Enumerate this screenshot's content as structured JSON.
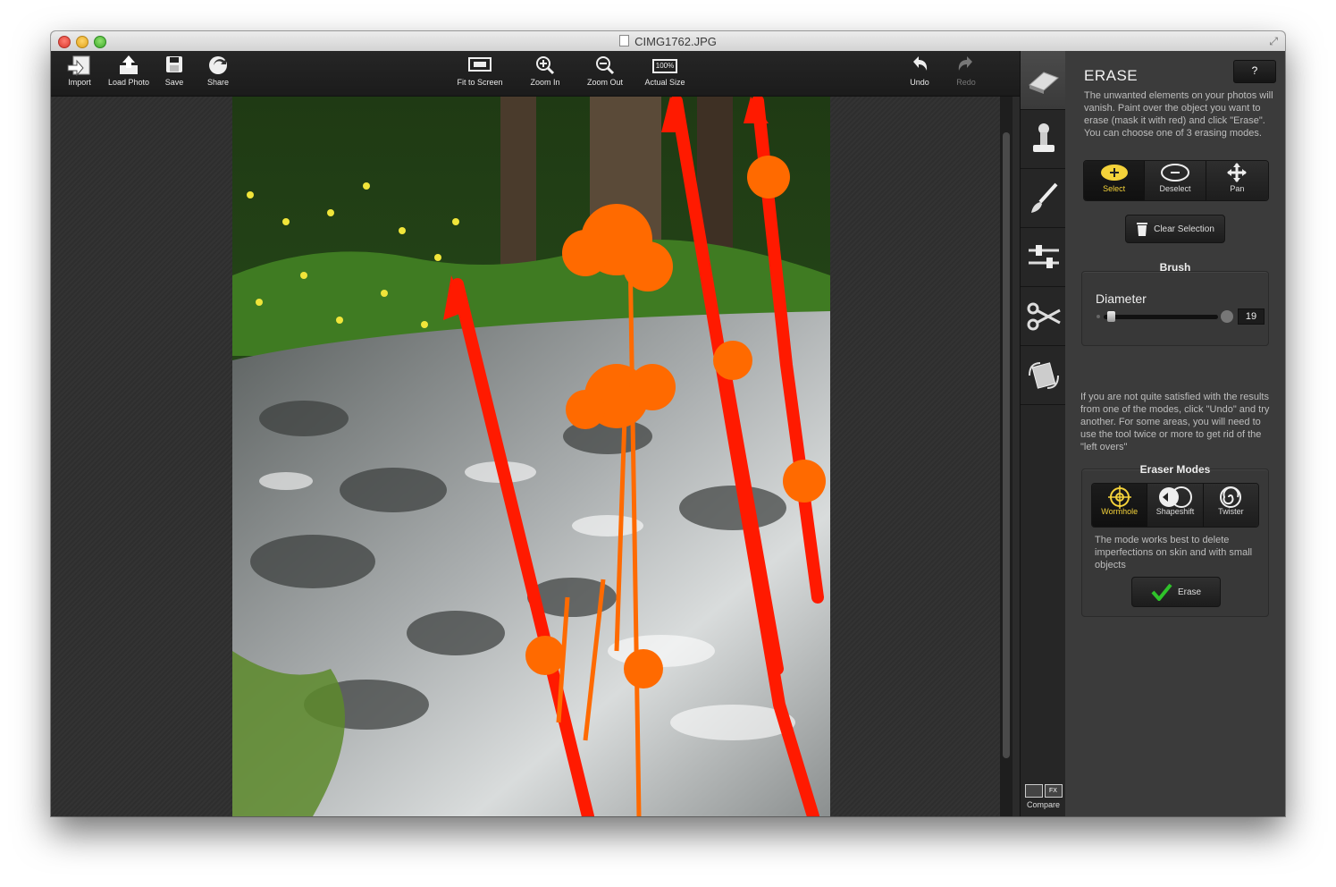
{
  "window": {
    "title": "CIMG1762.JPG"
  },
  "toolbar": {
    "import": "Import",
    "load_photo": "Load Photo",
    "save": "Save",
    "share": "Share",
    "fit_to_screen": "Fit to Screen",
    "zoom_in": "Zoom In",
    "zoom_out": "Zoom Out",
    "actual_size": "Actual Size",
    "actual_size_icon_text": "100%",
    "undo": "Undo",
    "redo": "Redo"
  },
  "toolstrip": {
    "tools": [
      "eraser-icon",
      "stamp-icon",
      "brush-icon",
      "sliders-icon",
      "scissors-icon",
      "rotate-icon"
    ],
    "compare_label": "Compare",
    "compare_fx": "FX"
  },
  "panel": {
    "title": "ERASE",
    "help_label": "?",
    "description": "The unwanted elements on your photos will vanish. Paint over the object you want to erase (mask it with red) and click \"Erase\". You can choose one of 3 erasing modes.",
    "selection_modes": [
      {
        "label": "Select",
        "active": true
      },
      {
        "label": "Deselect",
        "active": false
      },
      {
        "label": "Pan",
        "active": false
      }
    ],
    "clear_selection": "Clear Selection",
    "brush": {
      "title": "Brush",
      "diameter_label": "Diameter",
      "diameter_value": "19",
      "diameter_fraction": 0.06
    },
    "tip": "If you are not quite satisfied with the results from one of the modes, click \"Undo\" and try another. For some areas, you will need to use the tool twice or more to get rid of the \"left overs\"",
    "eraser_modes": {
      "title": "Eraser Modes",
      "modes": [
        {
          "label": "Wormhole",
          "active": true
        },
        {
          "label": "Shapeshift",
          "active": false
        },
        {
          "label": "Twister",
          "active": false
        }
      ],
      "mode_description": "The mode works best to delete imperfections on skin and with small objects",
      "erase_button": "Erase"
    }
  },
  "colors": {
    "accent_yellow": "#f4d23a",
    "mask_red": "#ff1a00",
    "panel_bg": "#3b3b3b",
    "erase_check": "#2fc22a"
  }
}
